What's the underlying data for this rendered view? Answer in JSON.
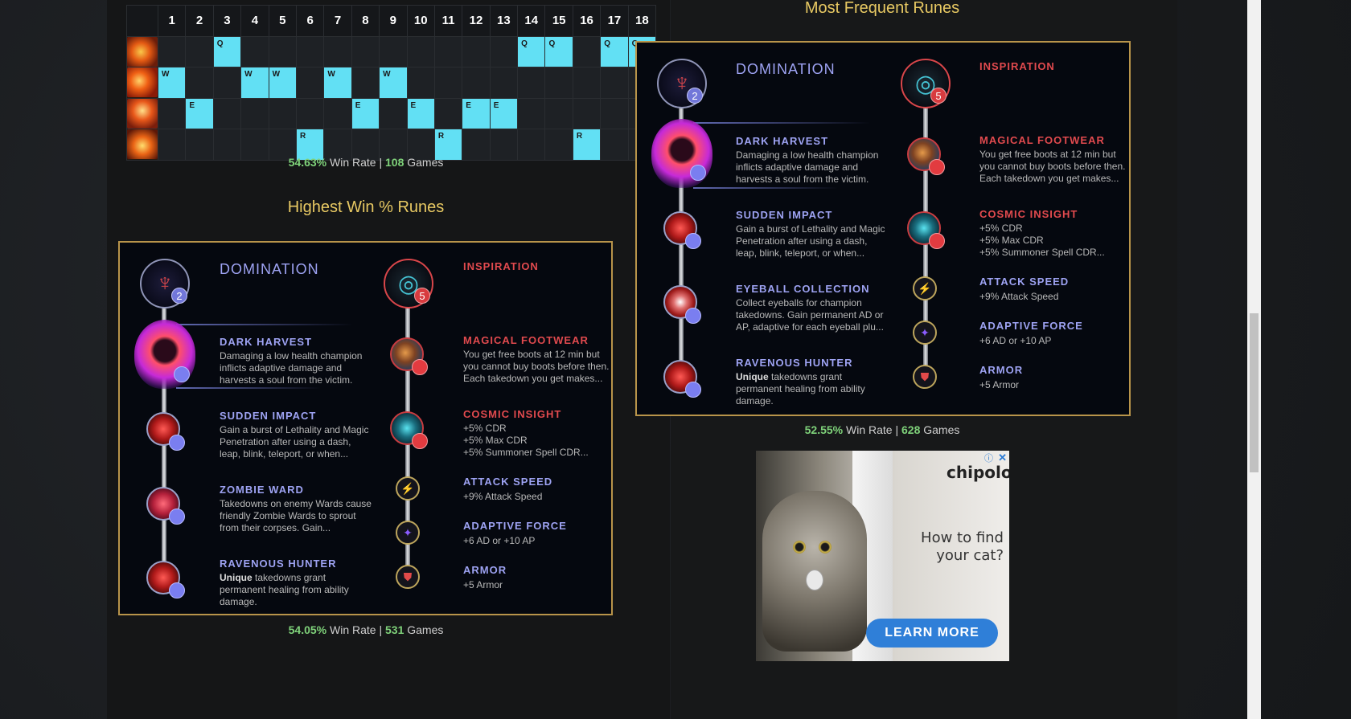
{
  "skill_order": {
    "levels": [
      "1",
      "2",
      "3",
      "4",
      "5",
      "6",
      "7",
      "8",
      "9",
      "10",
      "11",
      "12",
      "13",
      "14",
      "15",
      "16",
      "17",
      "18"
    ],
    "rows": [
      {
        "ability": "Q",
        "icon": "ability-q-icon",
        "cells": [
          "",
          "",
          "Q",
          "",
          "",
          "",
          "",
          "",
          "",
          "",
          "",
          "",
          "",
          "Q",
          "Q",
          "",
          "Q",
          "Q"
        ]
      },
      {
        "ability": "W",
        "icon": "ability-w-icon",
        "cells": [
          "W",
          "",
          "",
          "W",
          "W",
          "",
          "W",
          "",
          "W",
          "",
          "",
          "",
          "",
          "",
          "",
          "",
          "",
          ""
        ]
      },
      {
        "ability": "E",
        "icon": "ability-e-icon",
        "cells": [
          "",
          "E",
          "",
          "",
          "",
          "",
          "",
          "E",
          "",
          "E",
          "",
          "E",
          "E",
          "",
          "",
          "",
          "",
          ""
        ]
      },
      {
        "ability": "R",
        "icon": "ability-r-icon",
        "cells": [
          "",
          "",
          "",
          "",
          "",
          "R",
          "",
          "",
          "",
          "",
          "R",
          "",
          "",
          "",
          "",
          "R",
          "",
          ""
        ]
      }
    ],
    "stats": {
      "win_rate": "54.63%",
      "win_rate_label": " Win Rate | ",
      "games": "108",
      "games_label": " Games"
    }
  },
  "highest_win_runes": {
    "title": "Highest Win % Runes",
    "primary": {
      "tree": "DOMINATION",
      "badge": "2",
      "runes": [
        {
          "name": "DARK HARVEST",
          "desc": "Damaging a low health champion inflicts adaptive damage and harvests a soul from the victim."
        },
        {
          "name": "SUDDEN IMPACT",
          "desc": "Gain a burst of Lethality and Magic Penetration after using a dash, leap, blink, teleport, or when..."
        },
        {
          "name": "ZOMBIE WARD",
          "desc": "Takedowns on enemy Wards cause friendly Zombie Wards to sprout from their corpses. Gain..."
        },
        {
          "name": "RAVENOUS HUNTER",
          "desc_bold": "Unique",
          "desc": " takedowns grant permanent healing from ability damage."
        }
      ]
    },
    "secondary": {
      "tree": "INSPIRATION",
      "badge": "5",
      "runes": [
        {
          "name": "MAGICAL FOOTWEAR",
          "desc": "You get free boots at 12 min but you cannot buy boots before then. Each takedown you get makes..."
        },
        {
          "name": "COSMIC INSIGHT",
          "desc_lines": [
            "+5% CDR",
            "+5% Max CDR",
            "+5% Summoner Spell CDR..."
          ]
        }
      ],
      "shards": [
        {
          "name": "ATTACK SPEED",
          "desc": "+9% Attack Speed"
        },
        {
          "name": "ADAPTIVE FORCE",
          "desc": "+6 AD or +10 AP"
        },
        {
          "name": "ARMOR",
          "desc": "+5 Armor"
        }
      ]
    },
    "stats": {
      "win_rate": "54.05%",
      "win_rate_label": " Win Rate | ",
      "games": "531",
      "games_label": " Games"
    }
  },
  "most_frequent_runes": {
    "title": "Most Frequent Runes",
    "primary": {
      "tree": "DOMINATION",
      "badge": "2",
      "runes": [
        {
          "name": "DARK HARVEST",
          "desc": "Damaging a low health champion inflicts adaptive damage and harvests a soul from the victim."
        },
        {
          "name": "SUDDEN IMPACT",
          "desc": "Gain a burst of Lethality and Magic Penetration after using a dash, leap, blink, teleport, or when..."
        },
        {
          "name": "EYEBALL COLLECTION",
          "desc": "Collect eyeballs for champion takedowns. Gain permanent AD or AP, adaptive for each eyeball plu..."
        },
        {
          "name": "RAVENOUS HUNTER",
          "desc_bold": "Unique",
          "desc": " takedowns grant permanent healing from ability damage."
        }
      ]
    },
    "secondary": {
      "tree": "INSPIRATION",
      "badge": "5",
      "runes": [
        {
          "name": "MAGICAL FOOTWEAR",
          "desc": "You get free boots at 12 min but you cannot buy boots before then. Each takedown you get makes..."
        },
        {
          "name": "COSMIC INSIGHT",
          "desc_lines": [
            "+5% CDR",
            "+5% Max CDR",
            "+5% Summoner Spell CDR..."
          ]
        }
      ],
      "shards": [
        {
          "name": "ATTACK SPEED",
          "desc": "+9% Attack Speed"
        },
        {
          "name": "ADAPTIVE FORCE",
          "desc": "+6 AD or +10 AP"
        },
        {
          "name": "ARMOR",
          "desc": "+5 Armor"
        }
      ]
    },
    "stats": {
      "win_rate": "52.55%",
      "win_rate_label": " Win Rate | ",
      "games": "628",
      "games_label": " Games"
    }
  },
  "ad": {
    "brand": "chipolo",
    "headline": "How to find your cat?",
    "cta": "LEARN MORE",
    "info_icon": "ⓘ",
    "close_icon": "✕"
  },
  "colors": {
    "level_cell": "#62e0f4",
    "gold_title": "#e8c963",
    "domination": "#9ea3f3",
    "inspiration": "#e14a4e",
    "win_green": "#7fd27a",
    "border_gold": "#b8944a"
  }
}
